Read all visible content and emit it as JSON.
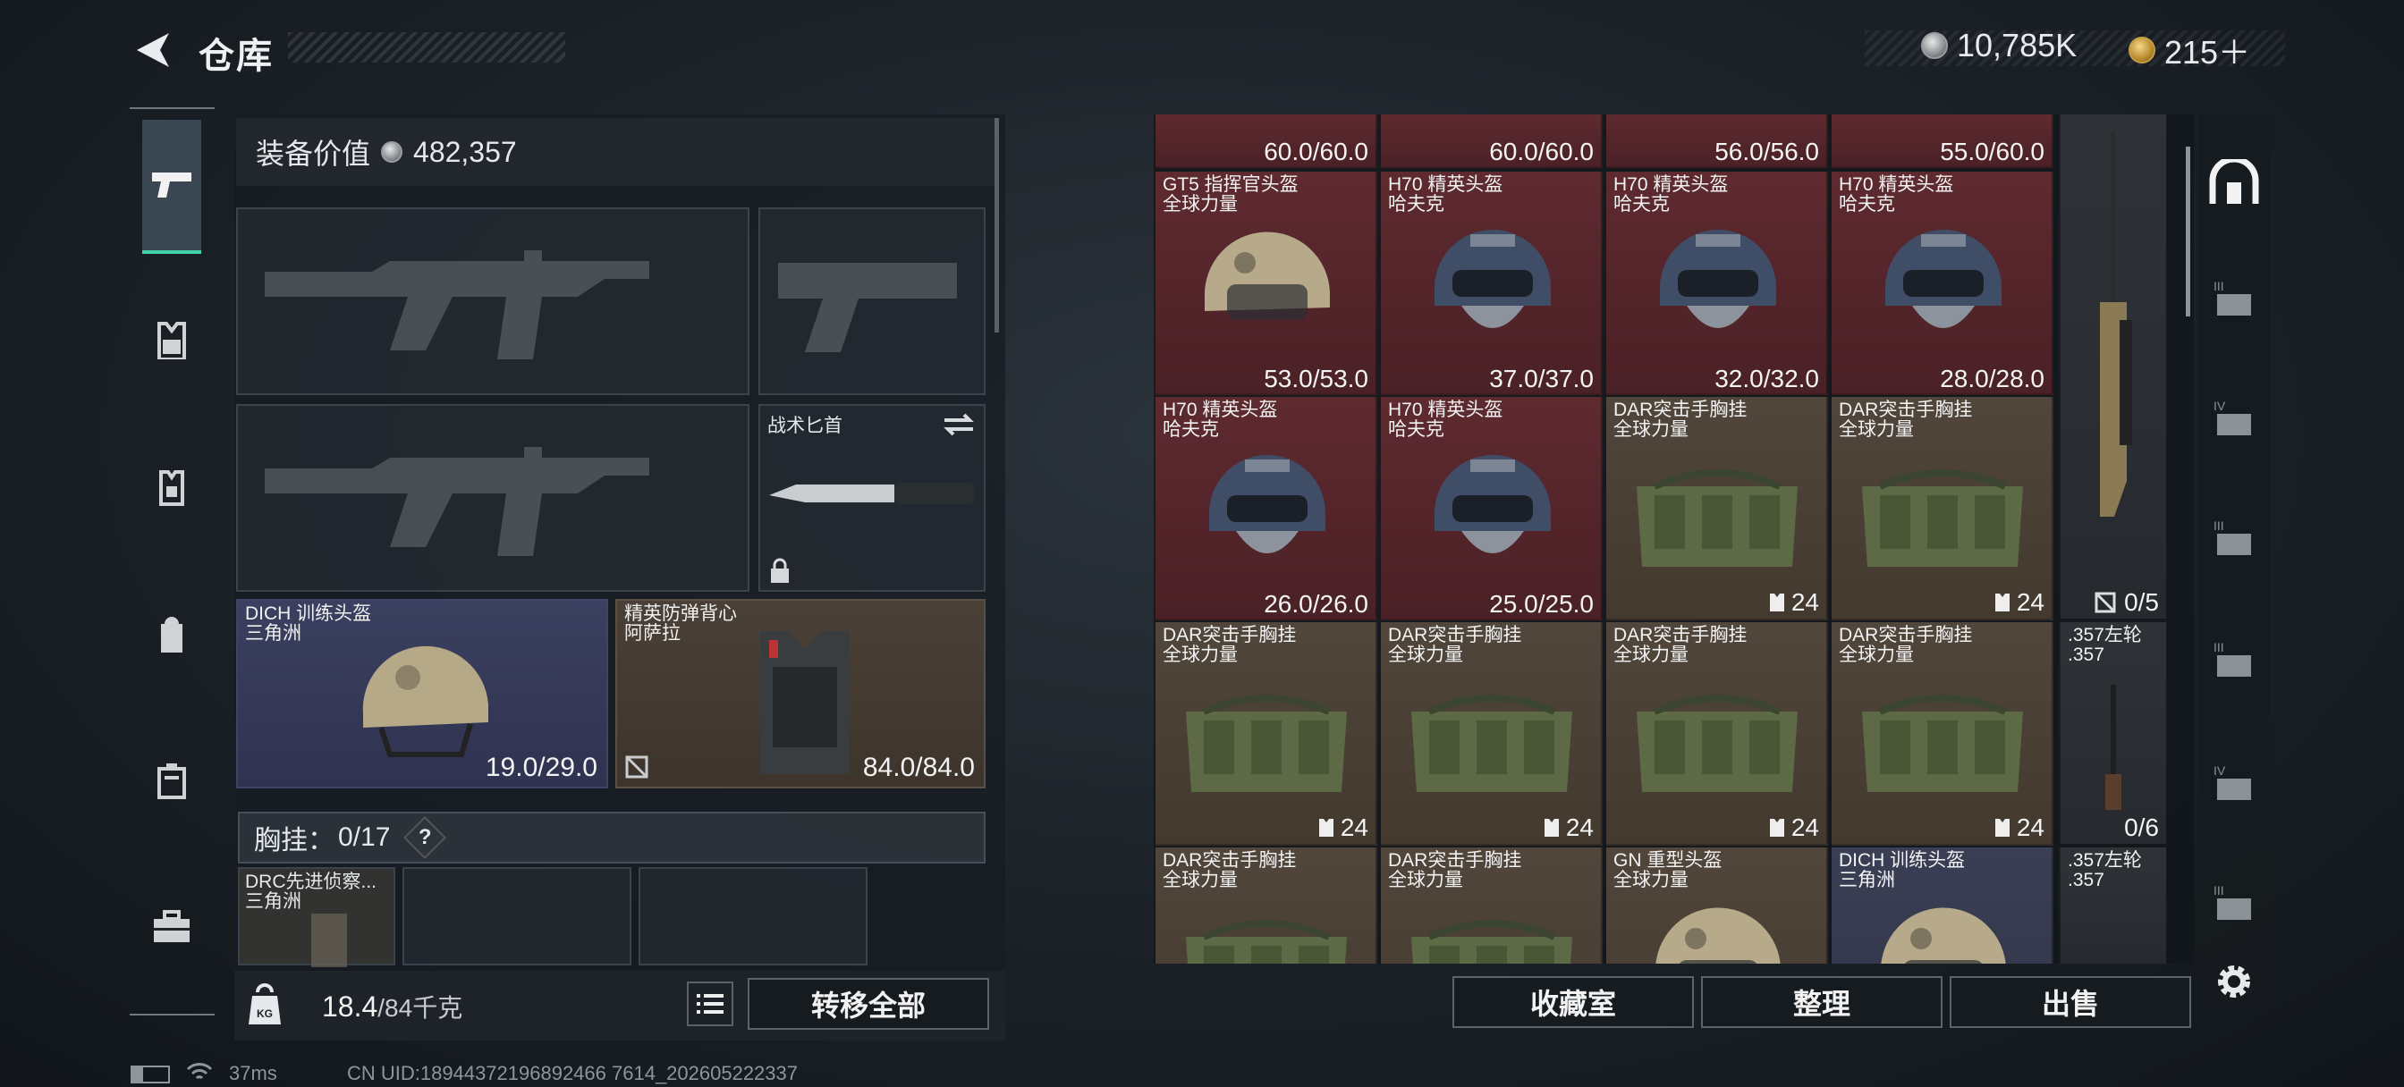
{
  "header": {
    "title": "仓库",
    "currency_silver": "10,785K",
    "currency_gold": "215＋"
  },
  "equipment": {
    "value_label": "装备价值",
    "value": "482,357",
    "knife_label": "战术匕首",
    "helmet": {
      "name": "DICH 训练头盔",
      "sub": "三角洲",
      "durability": "19.0/29.0"
    },
    "vest": {
      "name": "精英防弹背心",
      "sub": "阿萨拉",
      "durability": "84.0/84.0"
    },
    "chest_label": "胸挂：",
    "chest_capacity": "0/17",
    "chest_help": "?",
    "chest_item": {
      "name": "DRC先进侦察...",
      "sub": "三角洲"
    }
  },
  "footer": {
    "weight_value": "18.4",
    "weight_limit": "/84千克",
    "weight_icon": "KG",
    "transfer_all": "转移全部",
    "collection": "收藏室",
    "organize": "整理",
    "sell": "出售"
  },
  "inventory": {
    "top_row": [
      "60.0/60.0",
      "60.0/60.0",
      "56.0/56.0",
      "55.0/60.0"
    ],
    "rows": [
      [
        {
          "name": "GT5 指挥官头盔",
          "sub": "全球力量",
          "value": "53.0/53.0",
          "type": "helmet-tan",
          "bg": "red"
        },
        {
          "name": "H70 精英头盔",
          "sub": "哈夫克",
          "value": "37.0/37.0",
          "type": "helmet-navy",
          "bg": "red"
        },
        {
          "name": "H70 精英头盔",
          "sub": "哈夫克",
          "value": "32.0/32.0",
          "type": "helmet-navy",
          "bg": "red"
        },
        {
          "name": "H70 精英头盔",
          "sub": "哈夫克",
          "value": "28.0/28.0",
          "type": "helmet-navy",
          "bg": "red"
        }
      ],
      [
        {
          "name": "H70 精英头盔",
          "sub": "哈夫克",
          "value": "26.0/26.0",
          "type": "helmet-navy",
          "bg": "red"
        },
        {
          "name": "H70 精英头盔",
          "sub": "哈夫克",
          "value": "25.0/25.0",
          "type": "helmet-navy",
          "bg": "red"
        },
        {
          "name": "DAR突击手胸挂",
          "sub": "全球力量",
          "value": "24",
          "type": "rig",
          "bg": "brown"
        },
        {
          "name": "DAR突击手胸挂",
          "sub": "全球力量",
          "value": "24",
          "type": "rig",
          "bg": "brown"
        }
      ],
      [
        {
          "name": "DAR突击手胸挂",
          "sub": "全球力量",
          "value": "24",
          "type": "rig",
          "bg": "brown"
        },
        {
          "name": "DAR突击手胸挂",
          "sub": "全球力量",
          "value": "24",
          "type": "rig",
          "bg": "brown"
        },
        {
          "name": "DAR突击手胸挂",
          "sub": "全球力量",
          "value": "24",
          "type": "rig",
          "bg": "brown"
        },
        {
          "name": "DAR突击手胸挂",
          "sub": "全球力量",
          "value": "24",
          "type": "rig",
          "bg": "brown"
        }
      ],
      [
        {
          "name": "DAR突击手胸挂",
          "sub": "全球力量",
          "value": "",
          "type": "rig",
          "bg": "brown"
        },
        {
          "name": "DAR突击手胸挂",
          "sub": "全球力量",
          "value": "",
          "type": "rig",
          "bg": "brown"
        },
        {
          "name": "GN 重型头盔",
          "sub": "全球力量",
          "value": "",
          "type": "helmet-tan",
          "bg": "brown"
        },
        {
          "name": "DICH 训练头盔",
          "sub": "三角洲",
          "value": "",
          "type": "helmet-tan",
          "bg": "navy"
        }
      ]
    ],
    "weapons": [
      {
        "name": "",
        "sub": "",
        "value": "0/5"
      },
      {
        "name": ".357左轮",
        "sub": ".357",
        "value": "0/6"
      },
      {
        "name": ".357左轮",
        "sub": ".357",
        "value": ""
      }
    ]
  },
  "status_bar": {
    "ping": "37ms",
    "uid": "CN UID:18944372196892466 7614_202605222337"
  }
}
